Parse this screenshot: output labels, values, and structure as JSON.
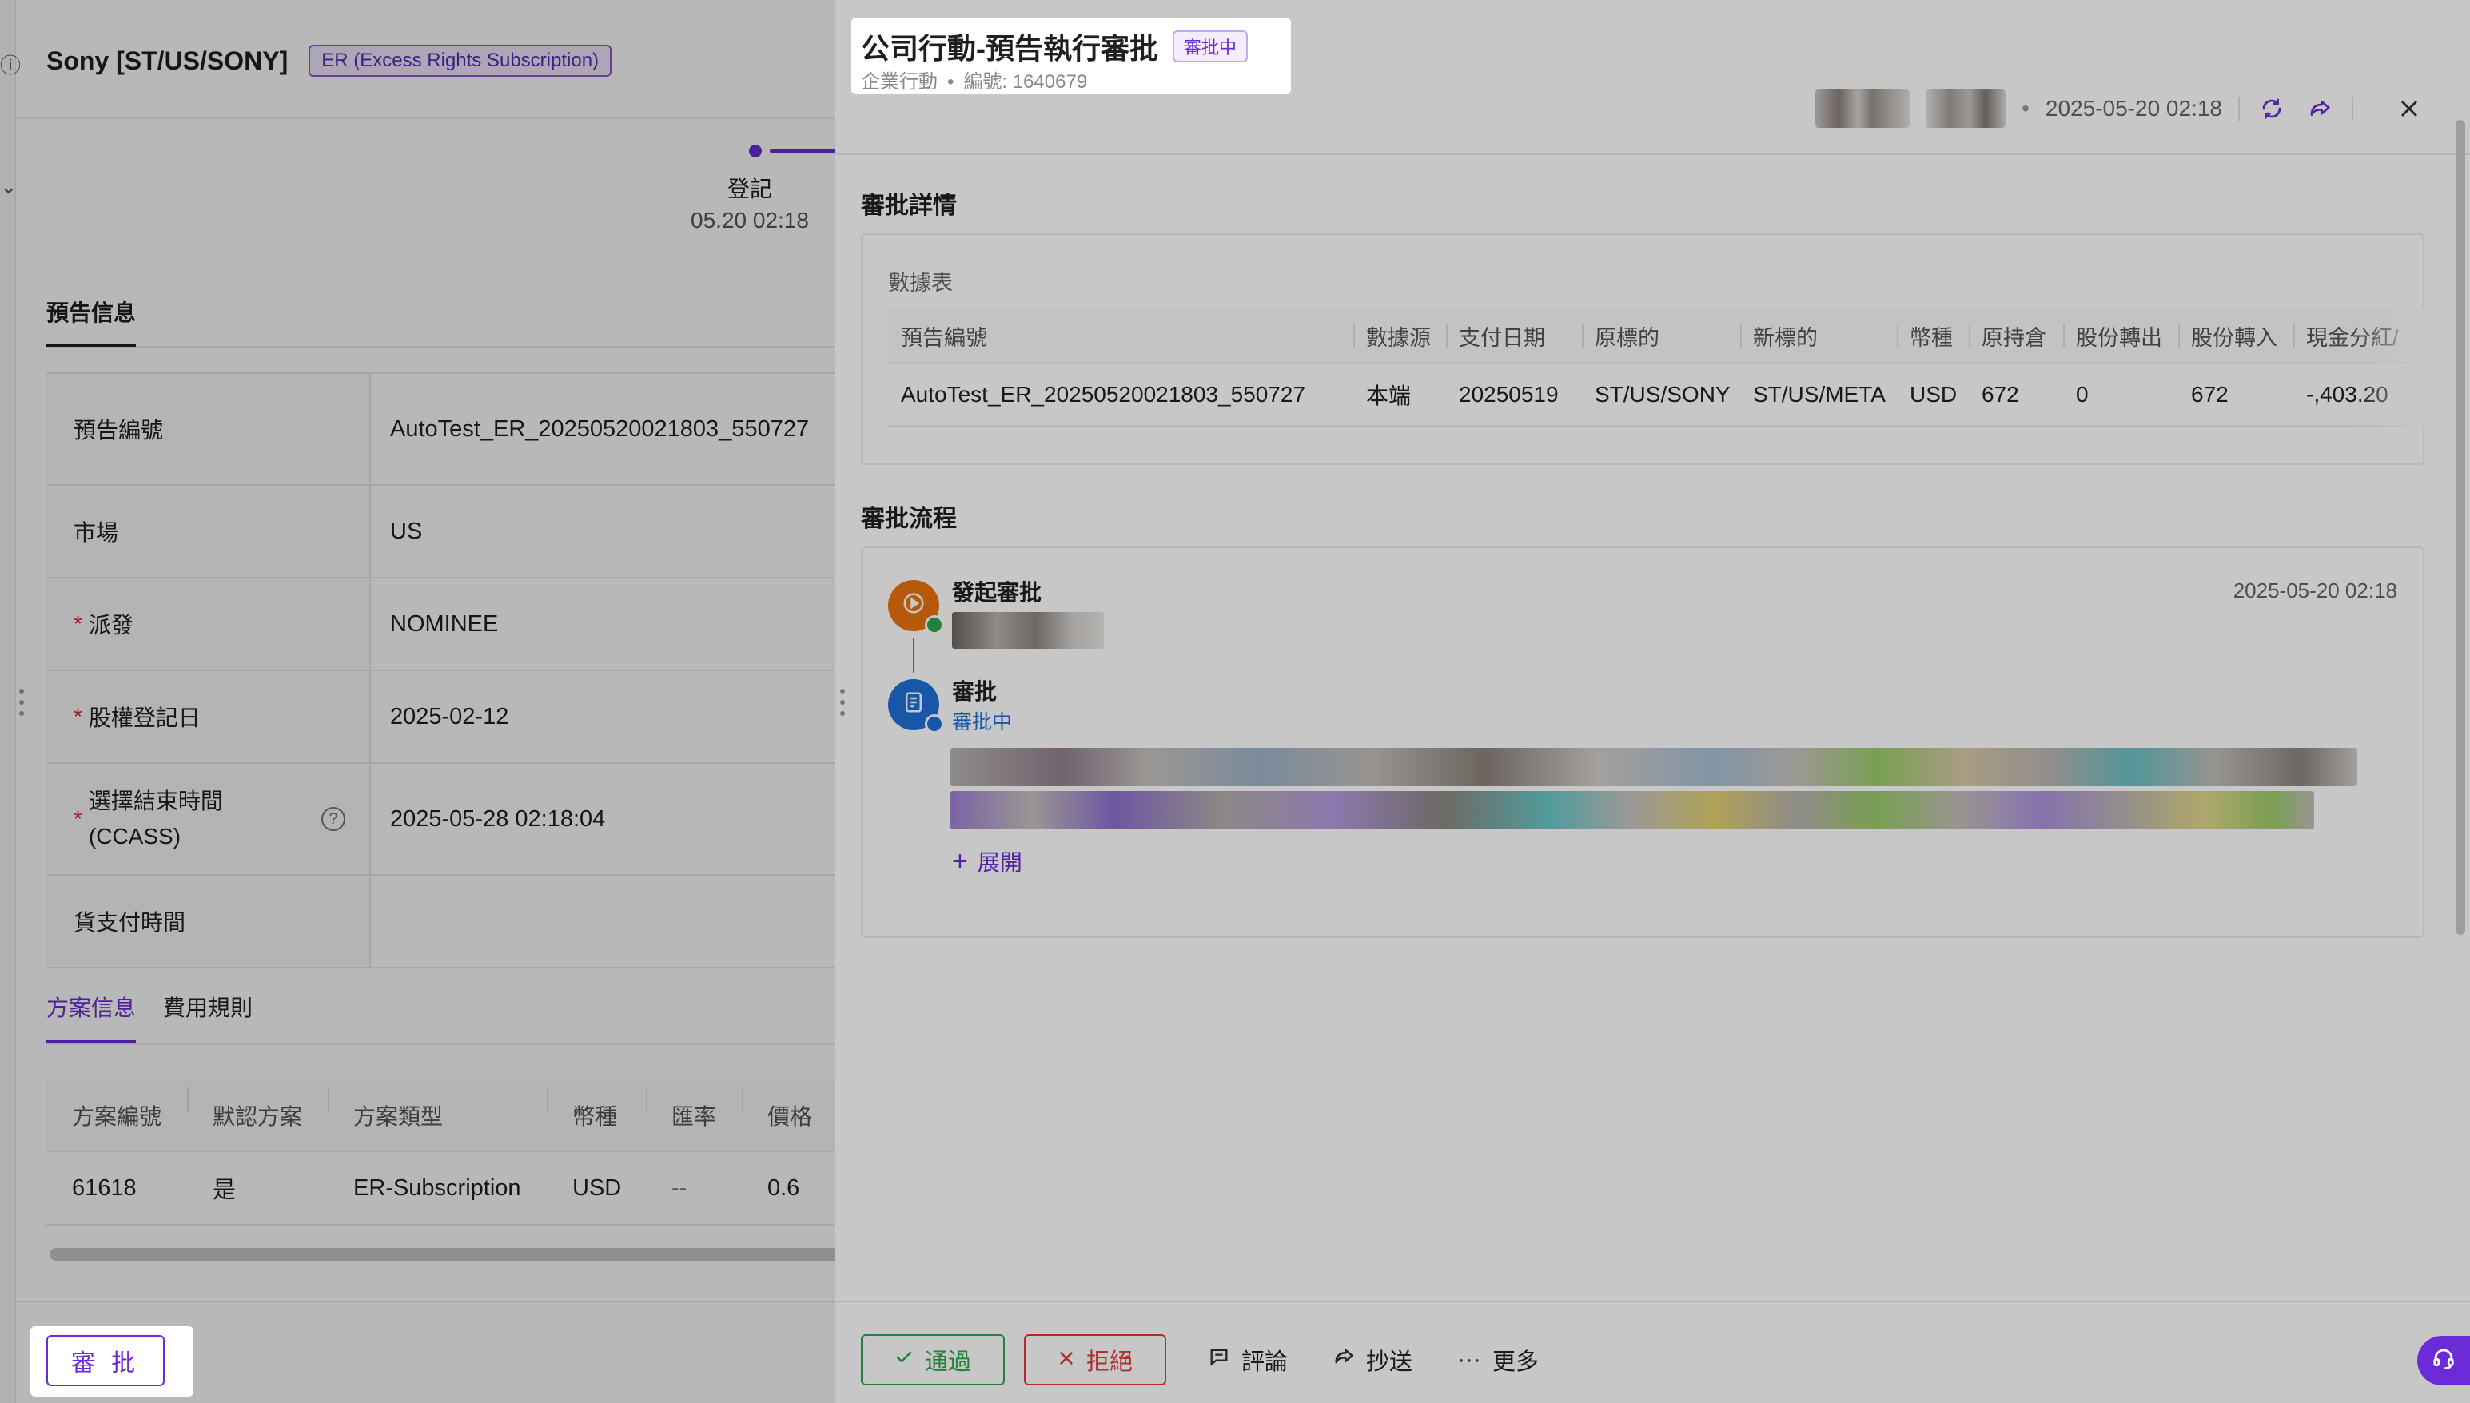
{
  "left_page": {
    "title": "Sony [ST/US/SONY]",
    "tag": "ER (Excess Rights Subscription)",
    "progress": {
      "label": "登記",
      "time": "05.20 02:18"
    },
    "section_title": "預告信息",
    "info_rows": [
      {
        "label": "預告編號",
        "required": false,
        "value": "AutoTest_ER_20250520021803_550727"
      },
      {
        "label": "市場",
        "required": false,
        "value": "US"
      },
      {
        "label": "派發",
        "required": true,
        "value": "NOMINEE"
      },
      {
        "label": "股權登記日",
        "required": true,
        "value": "2025-02-12"
      },
      {
        "label": "選擇結束時間 (CCASS)",
        "required": true,
        "value": "2025-05-28 02:18:04",
        "help": true
      },
      {
        "label": "貨支付時間",
        "required": false,
        "value": ""
      }
    ],
    "tabs": [
      {
        "label": "方案信息",
        "active": true
      },
      {
        "label": "費用規則",
        "active": false
      }
    ],
    "plan_table": {
      "columns": [
        "方案編號",
        "默認方案",
        "方案類型",
        "幣種",
        "匯率",
        "價格"
      ],
      "rows": [
        [
          "61618",
          "是",
          "ER-Subscription",
          "USD",
          "--",
          "0.6"
        ]
      ]
    },
    "approve_button": "審 批"
  },
  "drawer": {
    "title": "公司行動-預告執行審批",
    "status_badge": "審批中",
    "subtitle_app": "企業行動",
    "subtitle_id": "編號: 1640679",
    "timestamp": "2025-05-20 02:18",
    "details_title": "審批詳情",
    "data_caption": "數據表",
    "data_table": {
      "columns": [
        "預告編號",
        "數據源",
        "支付日期",
        "原標的",
        "新標的",
        "幣種",
        "原持倉",
        "股份轉出",
        "股份轉入",
        "現金分紅/"
      ],
      "rows": [
        [
          "AutoTest_ER_20250520021803_550727",
          "本端",
          "20250519",
          "ST/US/SONY",
          "ST/US/META",
          "USD",
          "672",
          "0",
          "672",
          "-,403.20"
        ]
      ]
    },
    "flow_title": "審批流程",
    "flow": {
      "step1_title": "發起審批",
      "step1_time": "2025-05-20 02:18",
      "step2_title": "審批",
      "step2_status": "審批中",
      "expand_label": "展開"
    },
    "footer": {
      "pass": "通過",
      "reject": "拒絕",
      "comment": "評論",
      "cc": "抄送",
      "more": "更多"
    }
  },
  "colors": {
    "accent": "#6b2bd6",
    "pass": "#2ea44f",
    "reject": "#e03a3a",
    "link_blue": "#1f6fd8",
    "initiator_orange": "#e8730f"
  },
  "icons": {
    "refresh": "refresh-icon",
    "share": "share-icon",
    "close": "close-icon",
    "check": "check-icon",
    "x": "x-icon",
    "comment": "comment-icon",
    "forward": "forward-icon",
    "more": "more-icon",
    "play": "play-icon",
    "document": "document-icon",
    "plus": "plus-icon",
    "help": "help-icon",
    "headset": "headset-icon"
  }
}
